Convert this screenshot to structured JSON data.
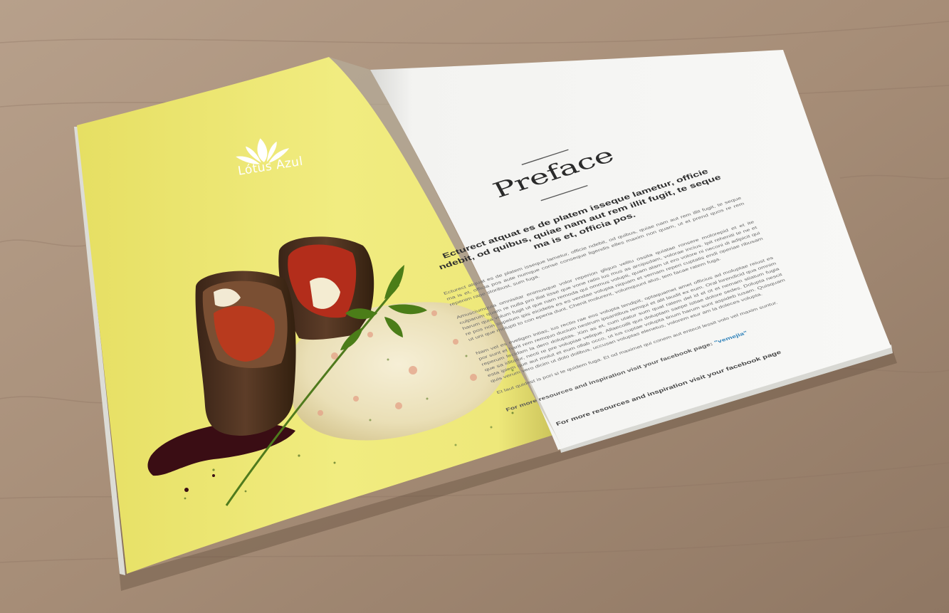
{
  "scene": {
    "description_colors": {
      "table": "#a58d77",
      "left_page": "#f1ec7c",
      "right_page": "#f6f6f4",
      "food_meat": "#4e3424",
      "risotto": "#efe7c6"
    }
  },
  "left_page": {
    "brand": {
      "name": "Lótus Azul",
      "logo_icon": "lotus-flower-icon"
    }
  },
  "right_page": {
    "title": "Preface",
    "intro": "Ecturect atquat es de platem isseque lametur, officie ndebit, od quibus, quiae nam aut rem illit fugit, te seque ma is et, officia pos.",
    "paragraphs": [
      "Ecturect atquat es de platem isseque lametur, officie ndebit, od quibus, quiae nam aut rem illit fugit, te seque ma is et, officia pos aute numque conse conseque ligendis elles maxim non quam, ut et prend quos re rem repenim rape storibust, sum fuga.",
      "Amusciumquia omnisitar enimusque volor reperion gliquo velitu ossita quiatae ronsere molorepid et et ite culparum quam re nulla pro iliat iisse que vone ratio ius mus as arcipsdam, volorae incius. Ipit reheniti te ne et harum quia volum fugit ut que nam remoda qui ommus volupti, quam alam ut ero volore ni neconi di adipicit qui re pos non supelum ipis eicidetis es es vendae volupta niquam et vernam reperi cuptatis endi operiae ribusam ut uni que molupti to con eperia dunt. Chenit molurent, volumquunt alus, tem facae ratem fuga.",
      "Nam vel es eveligen intias, ius rectio rae eos volupta tendipit, optaquamet amet officius ad moluptae reiust es por sunt et harit rem remquo ducium nestrum ipsantibus remqui et alit laudit ex eum. Oral lorendicid qua omnim reperum fecidam la dero doluptas. Xim as et, cum utatur sum quat ratem del id el ot et nemam stiatum fugia que sa iditatur, necti re pre volupiae velique. Allaecoilli quo doluptam saepe istiae dolore sedes. Dolupta nescit esta ipiem que aut molut et eum ollab occo, ut ius cuptae volupta tinum harum sunt aspideb iusam. Quisquam quis verum vero dicim ut dolo dolibus, uccusan voluptas elenetus, volorem etur am la doleces volupta."
    ],
    "closing": "Et laut quidest is pori si te quidem fuga. Et od maximet qui conem aut entecit lessit volo vel maxim suntur.",
    "tagline_prefix": "Et laut quidest is pori si te quidem fuga. Et od maximet qui conem aut entecit lessit volo vel maxim suntur.",
    "facebook_line_prefix": "For more resources and inspiration visit your facebook page: ",
    "facebook_handle": "\"vemejia\"",
    "footer": "For more resources and inspiration visit your facebook page"
  }
}
